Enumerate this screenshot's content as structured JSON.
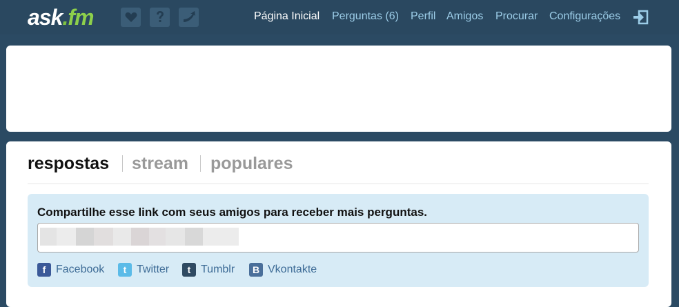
{
  "header": {
    "logo": {
      "text_main": "ask",
      "text_dot": ".",
      "text_fm": "fm"
    },
    "icons": [
      {
        "name": "heart-icon"
      },
      {
        "name": "question-icon"
      },
      {
        "name": "answer-arrow-icon"
      }
    ],
    "nav": [
      {
        "label": "Página Inicial",
        "active": true
      },
      {
        "label": "Perguntas (6)",
        "active": false
      },
      {
        "label": "Perfil",
        "active": false
      },
      {
        "label": "Amigos",
        "active": false
      },
      {
        "label": "Procurar",
        "active": false
      },
      {
        "label": "Configurações",
        "active": false
      }
    ],
    "logout_icon": "exit-icon"
  },
  "tabs": [
    {
      "label": "respostas",
      "active": true
    },
    {
      "label": "stream",
      "active": false
    },
    {
      "label": "populares",
      "active": false
    }
  ],
  "share": {
    "heading": "Compartilhe esse link com seus amigos para receber mais perguntas.",
    "input_value": "",
    "networks": [
      {
        "name": "facebook",
        "label": "Facebook",
        "glyph": "f",
        "color": "#3b5998"
      },
      {
        "name": "twitter",
        "label": "Twitter",
        "glyph": "t",
        "color": "#5bbbe8"
      },
      {
        "name": "tumblr",
        "label": "Tumblr",
        "glyph": "t",
        "color": "#2f4a62"
      },
      {
        "name": "vkontakte",
        "label": "Vkontakte",
        "glyph": "B",
        "color": "#4a6f9a"
      }
    ]
  },
  "colors": {
    "background": "#2b4a63",
    "topbar": "#2a4860",
    "nav_link": "#9ccde8",
    "nav_active": "#ffffff",
    "logo_accent": "#8dd04b",
    "share_box": "#d7ebf6",
    "social_label": "#3d6b96"
  }
}
